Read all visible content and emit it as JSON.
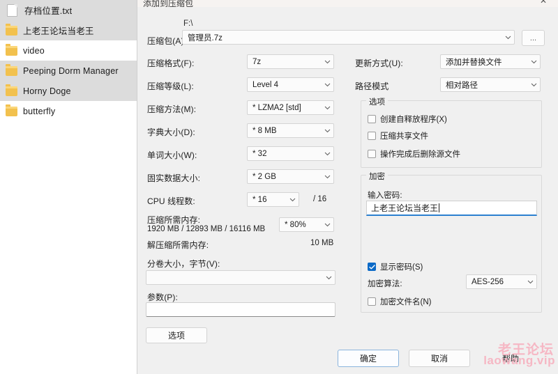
{
  "filelist": {
    "items": [
      {
        "name": "存档位置.txt",
        "icon": "text-file-icon",
        "type": "file",
        "selected": true
      },
      {
        "name": "上老王论坛当老王",
        "icon": "folder-icon",
        "type": "folder",
        "selected": true
      },
      {
        "name": "video",
        "icon": "folder-icon",
        "type": "folder",
        "selected": false
      },
      {
        "name": "Peeping Dorm Manager",
        "icon": "folder-icon",
        "type": "folder",
        "selected": true
      },
      {
        "name": "Horny Doge",
        "icon": "folder-icon",
        "type": "folder",
        "selected": true
      },
      {
        "name": "butterfly",
        "icon": "folder-icon",
        "type": "folder",
        "selected": false
      }
    ]
  },
  "dialog": {
    "title": "添加到压缩包",
    "close_label": "✕",
    "archive": {
      "label": "压缩包(A):",
      "path": "F:\\",
      "value": "管理员.7z",
      "browse_label": "..."
    },
    "left_fields": [
      {
        "label": "压缩格式(F):",
        "value": "7z"
      },
      {
        "label": "压缩等级(L):",
        "value": "Level 4"
      },
      {
        "label": "压缩方法(M):",
        "value": "*  LZMA2 [std]"
      },
      {
        "label": "字典大小(D):",
        "value": "*  8 MB"
      },
      {
        "label": "单词大小(W):",
        "value": "*  32"
      },
      {
        "label": "固实数据大小:",
        "value": "*  2 GB"
      }
    ],
    "cpu": {
      "label": "CPU 线程数:",
      "value": "*  16",
      "total": "/ 16"
    },
    "memory": {
      "compress_label": "压缩所需内存:",
      "compress_value": "1920 MB / 12893 MB / 16116 MB",
      "percent": "* 80%",
      "decompress_label": "解压缩所需内存:",
      "decompress_value": "10 MB"
    },
    "volume": {
      "label": "分卷大小，字节(V):",
      "value": ""
    },
    "params": {
      "label": "参数(P):",
      "value": ""
    },
    "options_button": "选项",
    "right_fields": [
      {
        "label": "更新方式(U):",
        "value": "添加并替换文件"
      },
      {
        "label": "路径模式",
        "value": "相对路径"
      }
    ],
    "options_group": {
      "title": "选项",
      "checkboxes": [
        {
          "label": "创建自释放程序(X)",
          "checked": false
        },
        {
          "label": "压缩共享文件",
          "checked": false
        },
        {
          "label": "操作完成后删除源文件",
          "checked": false
        }
      ]
    },
    "encryption_group": {
      "title": "加密",
      "password_label": "输入密码:",
      "password_value": "上老王论坛当老王",
      "show_password": {
        "label": "显示密码(S)",
        "checked": true
      },
      "algorithm_label": "加密算法:",
      "algorithm_value": "AES-256",
      "encrypt_filenames": {
        "label": "加密文件名(N)",
        "checked": false
      }
    },
    "buttons": {
      "ok": "确定",
      "cancel": "取消",
      "help": "帮助"
    }
  },
  "watermark": {
    "line1": "老王论坛",
    "line2": "laowang.vip",
    "color": "#f6b7c4"
  }
}
